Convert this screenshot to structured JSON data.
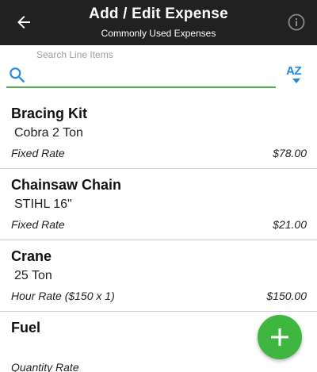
{
  "header": {
    "title": "Add / Edit Expense",
    "subtitle": "Commonly Used Expenses",
    "back_icon": "arrow-left-icon",
    "info_icon": "info-icon"
  },
  "search": {
    "label": "Search Line Items",
    "value": "",
    "sort_label": "AZ"
  },
  "items": [
    {
      "name": "Bracing Kit",
      "description": "Cobra 2 Ton",
      "rate": "Fixed Rate",
      "price": "$78.00"
    },
    {
      "name": "Chainsaw Chain",
      "description": "STIHL 16\"",
      "rate": "Fixed Rate",
      "price": "$21.00"
    },
    {
      "name": "Crane",
      "description": "25 Ton",
      "rate": "Hour Rate ($150 x 1)",
      "price": "$150.00"
    },
    {
      "name": "Fuel",
      "description": "",
      "rate": "Quantity Rate",
      "price": ""
    }
  ],
  "fab": {
    "icon": "plus-icon"
  },
  "colors": {
    "header_bg": "#212121",
    "accent_green": "#3fb63f",
    "underline_green": "#4caf50",
    "accent_blue": "#1e88e5"
  }
}
